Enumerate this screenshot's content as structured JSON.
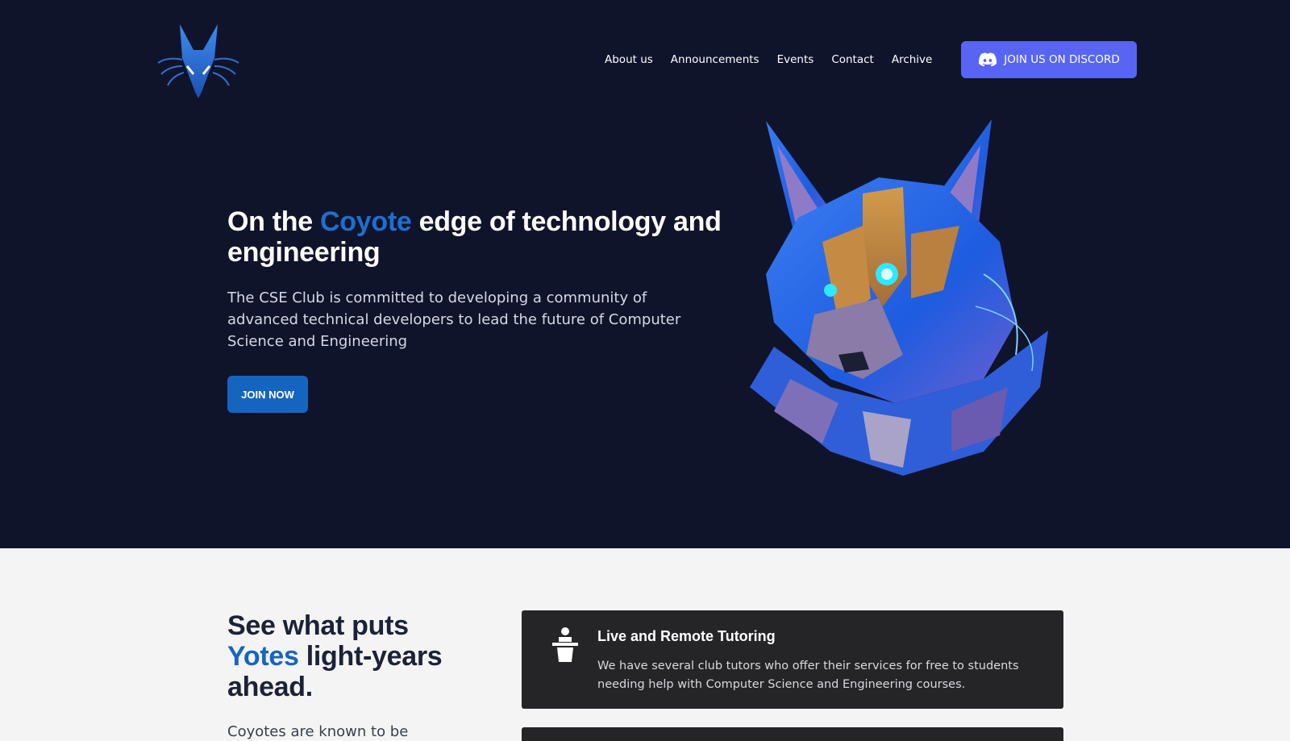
{
  "header": {
    "logo_icon": "coyote-logo-icon",
    "nav": [
      {
        "label": "About us"
      },
      {
        "label": "Announcements"
      },
      {
        "label": "Events"
      },
      {
        "label": "Contact"
      },
      {
        "label": "Archive"
      }
    ],
    "discord_button": {
      "label": "JOIN US ON DISCORD",
      "icon": "discord-icon",
      "color": "#5865f2"
    }
  },
  "hero": {
    "title_part1": "On the ",
    "title_accent": "Coyote",
    "title_part2": " edge of technology and engineering",
    "description": "The CSE Club is committed to developing a community of advanced technical developers to lead the future of Computer Science and Engineering",
    "cta_label": "JOIN NOW",
    "image_icon": "robotic-coyote-illustration",
    "background": "#10142b",
    "accent": "#1e6fd0"
  },
  "features": {
    "title_part1": "See what puts ",
    "title_accent": "Yotes",
    "title_part2": " light-years ahead.",
    "intro": "Coyotes are known to be",
    "cards": [
      {
        "icon": "lectern-tutor-icon",
        "title": "Live and Remote Tutoring",
        "text": "We have several club tutors who offer their services for free to students needing help with Computer Science and Engineering courses."
      }
    ]
  }
}
